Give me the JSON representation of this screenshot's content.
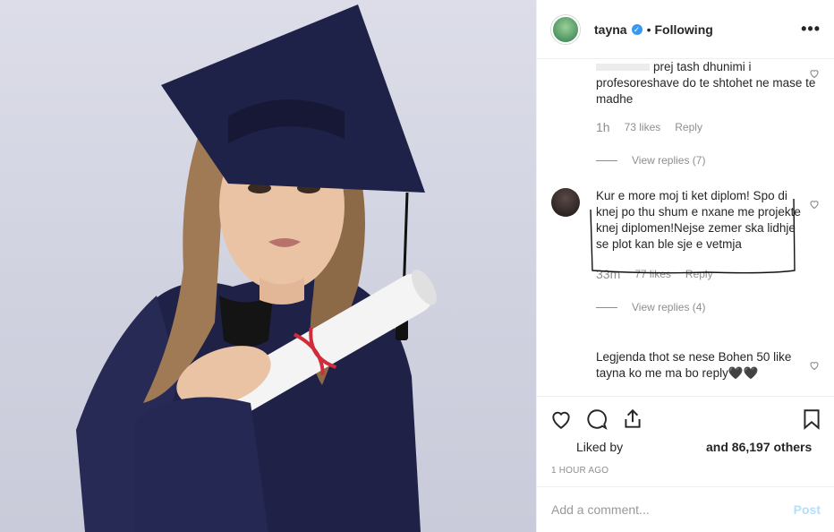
{
  "post": {
    "username": "tayna",
    "separator": "•",
    "follow_status": "Following",
    "more_icon": "more-options-icon",
    "colors": {
      "verified": "#3897f0",
      "post_button": "#b2dffc",
      "muted": "#8e8e8e",
      "text": "#262626"
    }
  },
  "comments": [
    {
      "text": "prej tash dhunimi i profesoreshave do te shtohet ne mase te madhe",
      "time": "1h",
      "likes": "73 likes",
      "reply": "Reply",
      "view_replies": "View replies (7)"
    },
    {
      "text": "Kur e more moj ti ket diplom! Spo di knej po thu shum e nxane me projekte knej diplomen!Nejse zemer ska lidhje se plot kan ble sje e vetmja",
      "time": "33m",
      "likes": "77 likes",
      "reply": "Reply",
      "view_replies": "View replies (4)"
    },
    {
      "text": "Legjenda thot se nese Bohen 50 like tayna ko me ma bo reply🖤🖤"
    }
  ],
  "actions": {
    "like_icon": "heart-icon",
    "comment_icon": "comment-icon",
    "share_icon": "share-icon",
    "save_icon": "bookmark-icon"
  },
  "likes": {
    "prefix": "Liked by",
    "suffix": "and 86,197 others"
  },
  "time_ago": "1 HOUR AGO",
  "add_comment": {
    "placeholder": "Add a comment...",
    "post_label": "Post"
  }
}
